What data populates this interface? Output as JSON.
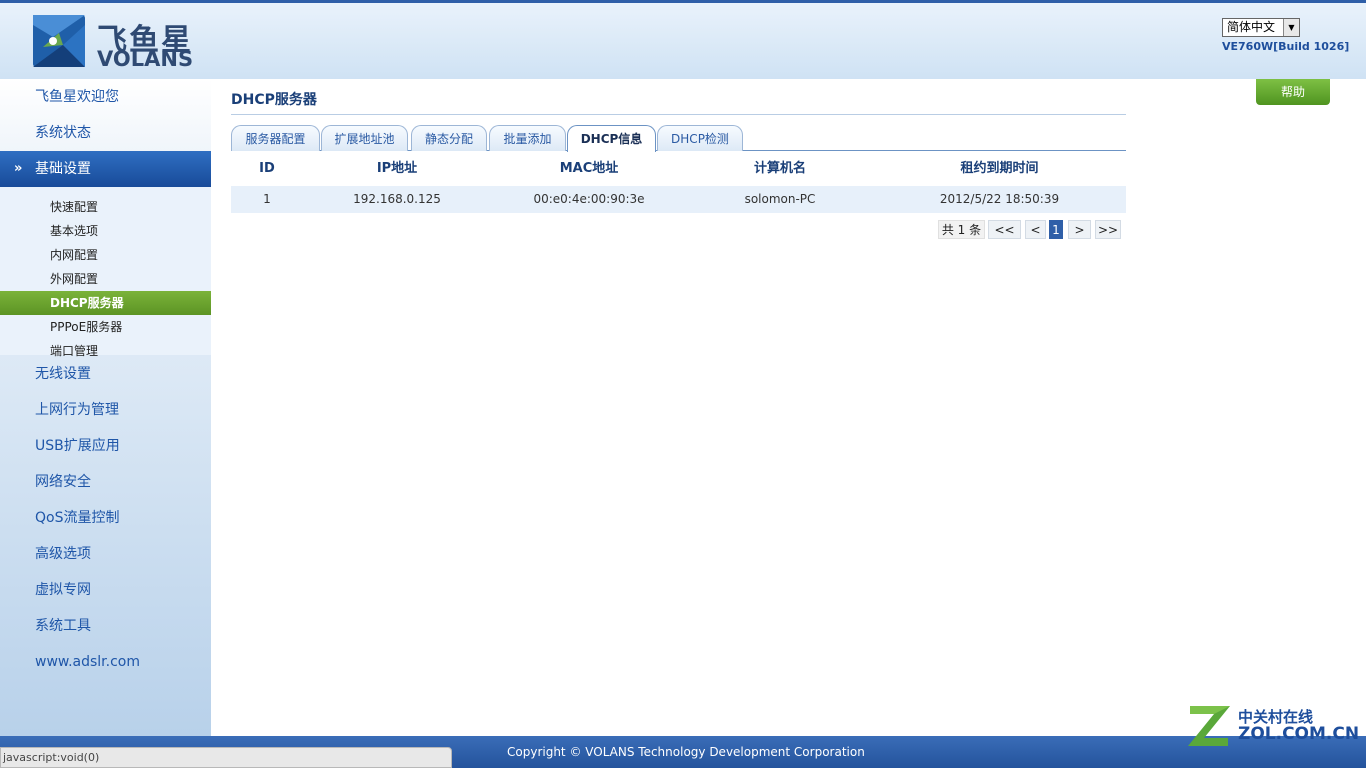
{
  "header": {
    "logo_cn": "飞鱼星",
    "logo_en": "VOLANS",
    "language": "简体中文",
    "version": "VE760W[Build 1026]"
  },
  "sidebar": {
    "items": [
      {
        "label": "飞鱼星欢迎您"
      },
      {
        "label": "系统状态"
      },
      {
        "label": "基础设置"
      },
      {
        "label": "无线设置"
      },
      {
        "label": "上网行为管理"
      },
      {
        "label": "USB扩展应用"
      },
      {
        "label": "网络安全"
      },
      {
        "label": "QoS流量控制"
      },
      {
        "label": "高级选项"
      },
      {
        "label": "虚拟专网"
      },
      {
        "label": "系统工具"
      },
      {
        "label": "www.adslr.com"
      }
    ],
    "sub_items": [
      {
        "label": "快速配置"
      },
      {
        "label": "基本选项"
      },
      {
        "label": "内网配置"
      },
      {
        "label": "外网配置"
      },
      {
        "label": "DHCP服务器"
      },
      {
        "label": "PPPoE服务器"
      },
      {
        "label": "端口管理"
      }
    ]
  },
  "main": {
    "title": "DHCP服务器",
    "help_label": "帮助",
    "tabs": [
      {
        "label": "服务器配置"
      },
      {
        "label": "扩展地址池"
      },
      {
        "label": "静态分配"
      },
      {
        "label": "批量添加"
      },
      {
        "label": "DHCP信息"
      },
      {
        "label": "DHCP检测"
      }
    ],
    "table": {
      "columns": [
        "ID",
        "IP地址",
        "MAC地址",
        "计算机名",
        "租约到期时间"
      ],
      "rows": [
        [
          "1",
          "192.168.0.125",
          "00:e0:4e:00:90:3e",
          "solomon-PC",
          "2012/5/22 18:50:39"
        ]
      ]
    },
    "pager": {
      "total": "共 1 条",
      "first": "<<",
      "prev": "<",
      "current": "1",
      "next": ">",
      "last": ">>"
    }
  },
  "footer": {
    "copyright": "Copyright © VOLANS Technology Development Corporation",
    "status": "javascript:void(0)",
    "watermark_cn": "中关村在线",
    "watermark_en": "ZOL.COM.CN"
  }
}
